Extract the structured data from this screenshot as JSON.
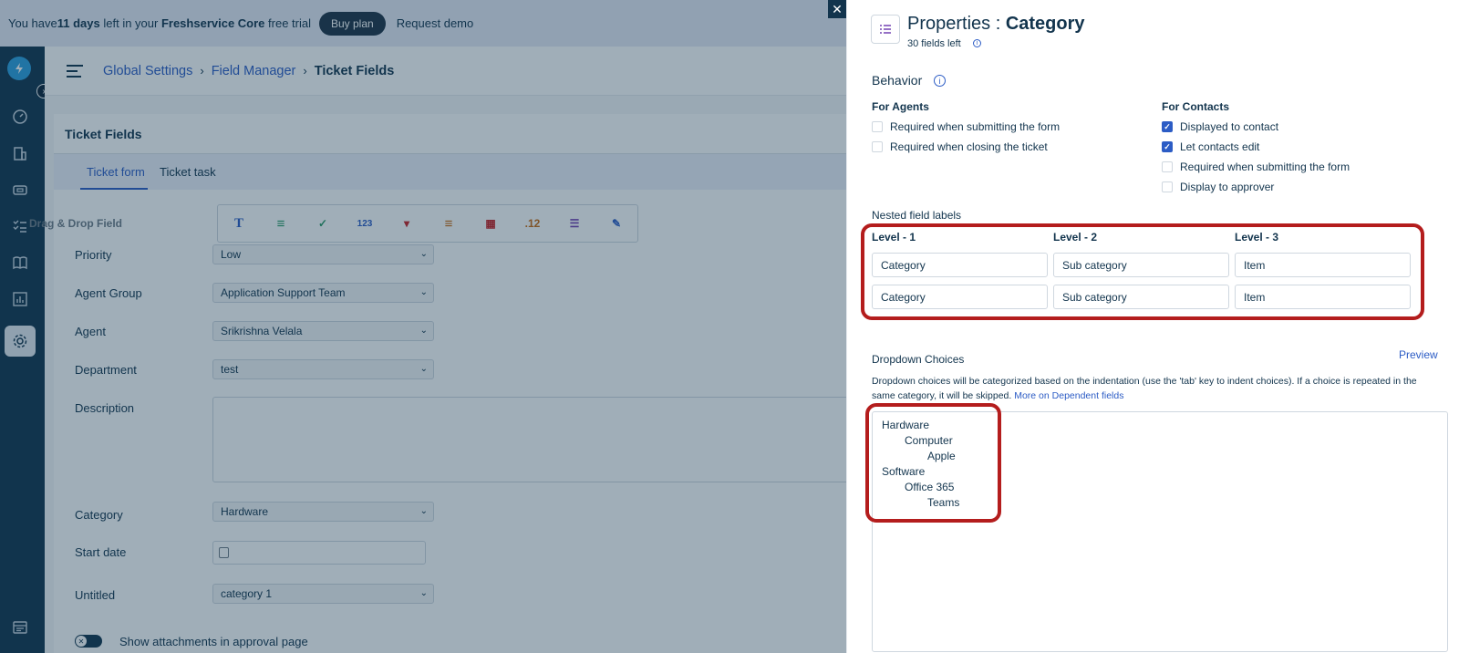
{
  "banner": {
    "prefix": "You have ",
    "days": "11 days",
    "middle": " left in your ",
    "product": "Freshservice Core",
    "suffix": " free trial",
    "buy_plan": "Buy plan",
    "request_demo": "Request demo"
  },
  "sidebar": {
    "items": [
      "dashboard-icon",
      "building-icon",
      "tickets-icon",
      "tasks-icon",
      "book-icon",
      "reports-icon",
      "settings-icon",
      "calendar-icon"
    ],
    "active": "settings-icon"
  },
  "breadcrumb": {
    "items": [
      "Global Settings",
      "Field Manager",
      "Ticket Fields"
    ]
  },
  "ticket_fields": {
    "title": "Ticket Fields",
    "tabs": [
      "Ticket form",
      "Ticket task"
    ],
    "active_tab": "Ticket form",
    "drag_drop_label": "Drag & Drop Field",
    "palette": [
      "T",
      "≡",
      "✓",
      "123",
      "▾",
      "≡",
      "▦",
      ".12",
      "☰",
      "✎"
    ]
  },
  "form": {
    "fields": [
      {
        "label": "Priority",
        "value": "Low"
      },
      {
        "label": "Agent Group",
        "value": "Application Support Team"
      },
      {
        "label": "Agent",
        "value": "Srikrishna Velala"
      },
      {
        "label": "Department",
        "value": "test"
      },
      {
        "label": "Description",
        "value": ""
      },
      {
        "label": "Category",
        "value": "Hardware"
      },
      {
        "label": "Start date",
        "value": ""
      },
      {
        "label": "Untitled",
        "value": "category 1"
      }
    ],
    "attachments_label": "Show attachments in approval page"
  },
  "panel": {
    "title_prefix": "Properties : ",
    "title_name": "Category",
    "fields_left": "30 fields left",
    "behavior": "Behavior",
    "for_agents": {
      "heading": "For Agents",
      "options": [
        {
          "label": "Required when submitting the form",
          "checked": false
        },
        {
          "label": "Required when closing the ticket",
          "checked": false
        }
      ]
    },
    "for_contacts": {
      "heading": "For Contacts",
      "options": [
        {
          "label": "Displayed to contact",
          "checked": true
        },
        {
          "label": "Let contacts edit",
          "checked": true
        },
        {
          "label": "Required when submitting the form",
          "checked": false
        },
        {
          "label": "Display to approver",
          "checked": false
        }
      ]
    },
    "nested_labels_heading": "Nested field labels",
    "levels": [
      "Level - 1",
      "Level - 2",
      "Level - 3"
    ],
    "level_rows": [
      [
        "Category",
        "Sub category",
        "Item"
      ],
      [
        "Category",
        "Sub category",
        "Item"
      ]
    ],
    "dropdown_heading": "Dropdown Choices",
    "preview": "Preview",
    "dropdown_help": "Dropdown choices will be categorized based on the indentation (use the 'tab' key to indent choices). If a choice is repeated in the same category, it will be skipped. ",
    "dropdown_help_link": "More on Dependent fields",
    "choices": [
      {
        "text": "Hardware",
        "level": 0
      },
      {
        "text": "Computer",
        "level": 1
      },
      {
        "text": "Apple",
        "level": 2
      },
      {
        "text": "Software",
        "level": 0
      },
      {
        "text": "Office 365",
        "level": 1
      },
      {
        "text": "Teams",
        "level": 2
      }
    ],
    "highlight_color": "#b41d1d"
  }
}
